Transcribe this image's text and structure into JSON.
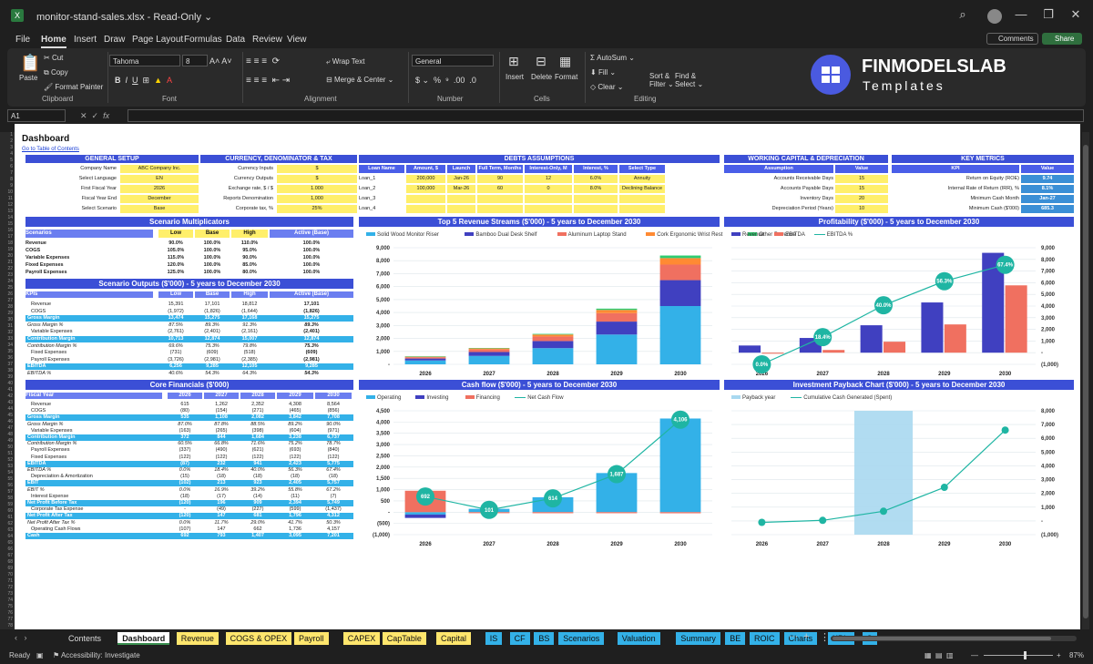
{
  "window": {
    "filename": "monitor-stand-sales.xlsx",
    "readonly": "Read-Only",
    "chevron": "⌄"
  },
  "menu": [
    "File",
    "Home",
    "Insert",
    "Draw",
    "Page Layout",
    "Formulas",
    "Data",
    "Review",
    "View"
  ],
  "menu_right": {
    "comments": "Comments",
    "share": "Share"
  },
  "ribbon": {
    "clipboard": {
      "paste": "Paste",
      "cut": "Cut",
      "copy": "Copy",
      "format_painter": "Format Painter",
      "label": "Clipboard"
    },
    "font": {
      "name": "Tahoma",
      "size": "8",
      "label": "Font"
    },
    "alignment": {
      "wrap": "Wrap Text",
      "merge": "Merge & Center",
      "label": "Alignment"
    },
    "number": {
      "format": "General",
      "label": "Number"
    },
    "cells": {
      "insert": "Insert",
      "delete": "Delete",
      "format": "Format",
      "label": "Cells"
    },
    "editing": {
      "autosum": "AutoSum",
      "fill": "Fill",
      "clear": "Clear",
      "sort": "Sort &",
      "filter": "Filter",
      "find": "Find &",
      "select": "Select",
      "label": "Editing"
    }
  },
  "logo": {
    "name": "FINMODELSLAB",
    "sub": "Templates"
  },
  "formula": {
    "cellref": "A1",
    "fx": "fx"
  },
  "columns": [
    "A",
    "B",
    "C",
    "D",
    "E",
    "F",
    "G",
    "H",
    "I",
    "J",
    "K",
    "L",
    "M",
    "N",
    "O",
    "P",
    "Q",
    "R",
    "S",
    "T",
    "U",
    "V",
    "W",
    "X",
    "Y",
    "Z",
    "AA",
    "AB",
    "AC",
    "AD"
  ],
  "dashboard": {
    "title": "Dashboard",
    "toc": "Go to Table of Contents"
  },
  "general_setup": {
    "title": "GENERAL SETUP",
    "rows": [
      [
        "Company Name",
        "ABC Company Inc."
      ],
      [
        "Select Language",
        "EN"
      ],
      [
        "First Fiscal Year",
        "2026"
      ],
      [
        "Fiscal Year End",
        "December"
      ],
      [
        "Select Scenario",
        "Base"
      ]
    ]
  },
  "currency": {
    "title": "CURRENCY, DENOMINATOR & TAX",
    "rows": [
      [
        "Currency Inputs",
        "$"
      ],
      [
        "Currency Outputs",
        "$"
      ],
      [
        "Exchange rate, $ / $",
        "1.000"
      ],
      [
        "Reports Denomination",
        "1,000"
      ],
      [
        "Corporate tax, %",
        "25%"
      ]
    ]
  },
  "debts": {
    "title": "DEBTS ASSUMPTIONS",
    "headers": [
      "Loan Name",
      "Amount, $",
      "Launch",
      "Full Term, Months",
      "Interest-Only, M",
      "Interest, %",
      "Select Type"
    ],
    "rows": [
      [
        "Loan_1",
        "200,000",
        "Jan-26",
        "90",
        "12",
        "6.0%",
        "Annuity"
      ],
      [
        "Loan_2",
        "100,000",
        "Mar-26",
        "60",
        "0",
        "8.0%",
        "Declining Balance"
      ],
      [
        "Loan_3",
        "",
        "",
        "",
        "",
        "",
        ""
      ],
      [
        "Loan_4",
        "",
        "",
        "",
        "",
        "",
        ""
      ]
    ]
  },
  "working_capital": {
    "title": "WORKING CAPITAL & DEPRECIATION",
    "headers": [
      "Assumption",
      "Value"
    ],
    "rows": [
      [
        "Accounts Receivable Days",
        "15"
      ],
      [
        "Accounts Payable Days",
        "15"
      ],
      [
        "Inventory Days",
        "20"
      ],
      [
        "Depreciation Period (Years)",
        "10"
      ]
    ]
  },
  "key_metrics": {
    "title": "KEY METRICS",
    "headers": [
      "KPI",
      "Value"
    ],
    "rows": [
      [
        "Return on Equity (ROE)",
        "9.74"
      ],
      [
        "Internal Rate of Return (IRR), %",
        "8.1%"
      ],
      [
        "Minimum Cash Month",
        "Jan-27"
      ],
      [
        "Minimum Cash ($'000)",
        "685.3"
      ]
    ]
  },
  "scenario_mult": {
    "title": "Scenario Multiplicators",
    "headers": [
      "Scenarios",
      "Low",
      "Base",
      "High",
      "Active (Base)"
    ],
    "rows": [
      [
        "Revenue",
        "90.0%",
        "100.0%",
        "110.0%",
        "100.0%"
      ],
      [
        "COGS",
        "105.0%",
        "100.0%",
        "95.0%",
        "100.0%"
      ],
      [
        "Variable Expenses",
        "115.0%",
        "100.0%",
        "90.0%",
        "100.0%"
      ],
      [
        "Fixed Expenses",
        "120.0%",
        "100.0%",
        "85.0%",
        "100.0%"
      ],
      [
        "Payroll Expenses",
        "125.0%",
        "100.0%",
        "80.0%",
        "100.0%"
      ]
    ]
  },
  "scenario_out": {
    "title": "Scenario Outputs ($'000) - 5 years to December 2030",
    "headers": [
      "KPIs",
      "Low",
      "Base",
      "High",
      "Active (Base)"
    ],
    "rows": [
      {
        "k": "Revenue",
        "v": [
          "15,391",
          "17,101",
          "18,812",
          "17,101"
        ],
        "s": "n"
      },
      {
        "k": "COGS",
        "v": [
          "(1,972)",
          "(1,826)",
          "(1,644)",
          "(1,826)"
        ],
        "s": "n"
      },
      {
        "k": "Gross Margin",
        "v": [
          "13,474",
          "15,275",
          "17,168",
          "15,275"
        ],
        "s": "b"
      },
      {
        "k": "Gross Margin %",
        "v": [
          "87.5%",
          "89.3%",
          "91.3%",
          "89.3%"
        ],
        "s": "i"
      },
      {
        "k": "Variable Expenses",
        "v": [
          "(2,761)",
          "(2,401)",
          "(2,161)",
          "(2,401)"
        ],
        "s": "n"
      },
      {
        "k": "Contribution Margin",
        "v": [
          "10,713",
          "12,874",
          "15,007",
          "12,874"
        ],
        "s": "b"
      },
      {
        "k": "Contribution Margin %",
        "v": [
          "69.6%",
          "75.3%",
          "79.8%",
          "75.3%"
        ],
        "s": "i"
      },
      {
        "k": "Fixed Expenses",
        "v": [
          "(731)",
          "(609)",
          "(518)",
          "(609)"
        ],
        "s": "n"
      },
      {
        "k": "Payroll Expenses",
        "v": [
          "(3,726)",
          "(2,981)",
          "(2,385)",
          "(2,981)"
        ],
        "s": "n"
      },
      {
        "k": "EBITDA",
        "v": [
          "6,256",
          "9,285",
          "12,105",
          "9,285"
        ],
        "s": "b"
      },
      {
        "k": "EBITDA %",
        "v": [
          "40.6%",
          "54.3%",
          "64.3%",
          "54.3%"
        ],
        "s": "i"
      }
    ]
  },
  "core": {
    "title": "Core Financials ($'000)",
    "headers": [
      "Fiscal Year",
      "2026",
      "2027",
      "2028",
      "2029",
      "2030"
    ],
    "rows": [
      {
        "k": "Revenue",
        "v": [
          "615",
          "1,262",
          "2,352",
          "4,308",
          "8,564"
        ],
        "s": "n"
      },
      {
        "k": "COGS",
        "v": [
          "(80)",
          "(154)",
          "(271)",
          "(465)",
          "(856)"
        ],
        "s": "n"
      },
      {
        "k": "Gross Margin",
        "v": [
          "535",
          "1,108",
          "2,082",
          "3,842",
          "7,708"
        ],
        "s": "b"
      },
      {
        "k": "Gross Margin %",
        "v": [
          "87.0%",
          "87.8%",
          "88.5%",
          "89.2%",
          "90.0%"
        ],
        "s": "i"
      },
      {
        "k": "Variable Expenses",
        "v": [
          "(163)",
          "(265)",
          "(398)",
          "(604)",
          "(971)"
        ],
        "s": "n"
      },
      {
        "k": "Contribution Margin",
        "v": [
          "372",
          "844",
          "1,684",
          "3,238",
          "6,737"
        ],
        "s": "b"
      },
      {
        "k": "Contribution Margin %",
        "v": [
          "60.5%",
          "66.8%",
          "71.6%",
          "75.2%",
          "78.7%"
        ],
        "s": "i"
      },
      {
        "k": "Payroll Expenses",
        "v": [
          "(337)",
          "(490)",
          "(621)",
          "(693)",
          "(840)"
        ],
        "s": "n"
      },
      {
        "k": "Fixed Expenses",
        "v": [
          "(122)",
          "(122)",
          "(122)",
          "(122)",
          "(122)"
        ],
        "s": "n"
      },
      {
        "k": "EBITDA",
        "v": [
          "(87)",
          "232",
          "941",
          "2,423",
          "5,775"
        ],
        "s": "b"
      },
      {
        "k": "EBITDA %",
        "v": [
          "0.0%",
          "18.4%",
          "40.0%",
          "56.3%",
          "67.4%"
        ],
        "s": "i"
      },
      {
        "k": "Depreciation & Amortization",
        "v": [
          "(15)",
          "(18)",
          "(18)",
          "(18)",
          "(18)"
        ],
        "s": "n"
      },
      {
        "k": "EBIT",
        "v": [
          "(102)",
          "213",
          "923",
          "2,405",
          "5,757"
        ],
        "s": "b"
      },
      {
        "k": "EBIT %",
        "v": [
          "0.0%",
          "16.9%",
          "39.2%",
          "55.8%",
          "67.2%"
        ],
        "s": "i"
      },
      {
        "k": "Interest Expense",
        "v": [
          "(18)",
          "(17)",
          "(14)",
          "(11)",
          "(7)"
        ],
        "s": "n"
      },
      {
        "k": "Net Profit Before Tax",
        "v": [
          "(120)",
          "196",
          "909",
          "2,394",
          "5,749"
        ],
        "s": "b"
      },
      {
        "k": "Corporate Tax Expense",
        "v": [
          "-",
          "(49)",
          "(227)",
          "(599)",
          "(1,437)"
        ],
        "s": "n"
      },
      {
        "k": "Net Profit After Tax",
        "v": [
          "(120)",
          "147",
          "681",
          "1,796",
          "4,312"
        ],
        "s": "b"
      },
      {
        "k": "Net Profit After Tax %",
        "v": [
          "0.0%",
          "11.7%",
          "29.0%",
          "41.7%",
          "50.3%"
        ],
        "s": "i"
      },
      {
        "k": "Operating Cash Flows",
        "v": [
          "(107)",
          "147",
          "662",
          "1,736",
          "4,157"
        ],
        "s": "n"
      },
      {
        "k": "Cash",
        "v": [
          "692",
          "793",
          "1,407",
          "3,095",
          "7,201"
        ],
        "s": "b"
      }
    ]
  },
  "colors": {
    "blue_dark": "#3b4fd6",
    "blue_light": "#33b1e8",
    "red": "#f07060",
    "teal": "#1fb5a3",
    "orange": "#ff8a33",
    "purple": "#4040c0",
    "yellow": "#ffef6b"
  },
  "chart_data": [
    {
      "type": "bar",
      "title": "Top 5 Revenue Streams ($'000) - 5 years to December 2030",
      "categories": [
        "2026",
        "2027",
        "2028",
        "2029",
        "2030"
      ],
      "ylim": [
        0,
        9000
      ],
      "yticks": [
        "-",
        "1,000",
        "2,000",
        "3,000",
        "4,000",
        "5,000",
        "6,000",
        "7,000",
        "8,000",
        "9,000"
      ],
      "series": [
        {
          "name": "Solid Wood Monitor Riser",
          "values": [
            300,
            650,
            1250,
            2300,
            4500
          ]
        },
        {
          "name": "Bamboo Dual Desk Shelf",
          "values": [
            150,
            300,
            550,
            1000,
            2000
          ]
        },
        {
          "name": "Aluminum Laptop Stand",
          "values": [
            100,
            200,
            350,
            650,
            1200
          ]
        },
        {
          "name": "Cork Ergonomic Wrist Rest",
          "values": [
            50,
            80,
            150,
            250,
            500
          ]
        },
        {
          "name": "Other Revenue",
          "values": [
            15,
            30,
            50,
            100,
            200
          ]
        }
      ],
      "stacked": true,
      "legend": "top"
    },
    {
      "type": "bar",
      "title": "Profitability ($'000) - 5 years to December 2030",
      "categories": [
        "2026",
        "2027",
        "2028",
        "2029",
        "2030"
      ],
      "ylim": [
        -1000,
        9000
      ],
      "yticks": [
        "(1,000)",
        "-",
        "1,000",
        "2,000",
        "3,000",
        "4,000",
        "5,000",
        "6,000",
        "7,000",
        "8,000",
        "9,000"
      ],
      "series": [
        {
          "name": "Revenue",
          "values": [
            615,
            1262,
            2352,
            4308,
            8564
          ]
        },
        {
          "name": "EBITDA",
          "values": [
            -87,
            232,
            941,
            2423,
            5775
          ]
        }
      ],
      "line": {
        "name": "EBITDA %",
        "values": [
          0.0,
          18.4,
          40.0,
          56.3,
          67.4
        ],
        "labels": [
          "0.0%",
          "18.4%",
          "40.0%",
          "56.3%",
          "67.4%"
        ]
      },
      "legend": "top"
    },
    {
      "type": "bar",
      "title": "Cash flow ($'000) - 5 years to December 2030",
      "categories": [
        "2026",
        "2027",
        "2028",
        "2029",
        "2030"
      ],
      "ylim": [
        -1000,
        4500
      ],
      "yticks": [
        "(1,000)",
        "(500)",
        "-",
        "500",
        "1,000",
        "1,500",
        "2,000",
        "2,500",
        "3,000",
        "3,500",
        "4,000",
        "4,500"
      ],
      "series": [
        {
          "name": "Operating",
          "values": [
            -107,
            147,
            662,
            1736,
            4157
          ]
        },
        {
          "name": "Investing",
          "values": [
            -150,
            0,
            0,
            0,
            0
          ]
        },
        {
          "name": "Financing",
          "values": [
            950,
            -46,
            -48,
            -48,
            -51
          ]
        }
      ],
      "line": {
        "name": "Net Cash Flow",
        "values": [
          692,
          101,
          614,
          1687,
          4106
        ],
        "labels": [
          "692",
          "101",
          "614",
          "1,687",
          "4,106"
        ]
      },
      "legend": "top"
    },
    {
      "type": "line",
      "title": "Investment Payback Chart ($'000) - 5 years to December 2030",
      "categories": [
        "2026",
        "2027",
        "2028",
        "2029",
        "2030"
      ],
      "ylim": [
        -1000,
        8000
      ],
      "yticks": [
        "(1,000)",
        "-",
        "1,000",
        "2,000",
        "3,000",
        "4,000",
        "5,000",
        "6,000",
        "7,000",
        "8,000"
      ],
      "series": [
        {
          "name": "Cumulative Cash Generated (Spent)",
          "values": [
            -107,
            40,
            702,
            2438,
            6595
          ]
        }
      ],
      "payback": {
        "name": "Payback year",
        "category": "2028"
      },
      "legend": "top"
    }
  ],
  "sheet_tabs": [
    {
      "n": "Contents",
      "c": "#1f1f1f",
      "t": "#ddd"
    },
    {
      "n": "Dashboard",
      "c": "#ffffff",
      "t": "#111"
    },
    {
      "n": "Revenue",
      "c": "#ffe66d",
      "t": "#111"
    },
    {
      "n": "COGS & OPEX",
      "c": "#ffe66d",
      "t": "#111"
    },
    {
      "n": "Payroll",
      "c": "#ffe66d",
      "t": "#111"
    },
    {
      "n": "CAPEX",
      "c": "#ffe66d",
      "t": "#111"
    },
    {
      "n": "CapTable",
      "c": "#ffe66d",
      "t": "#111"
    },
    {
      "n": "Capital",
      "c": "#ffe66d",
      "t": "#111"
    },
    {
      "n": "IS",
      "c": "#33b1e8",
      "t": "#111"
    },
    {
      "n": "CF",
      "c": "#33b1e8",
      "t": "#111"
    },
    {
      "n": "BS",
      "c": "#33b1e8",
      "t": "#111"
    },
    {
      "n": "Scenarios",
      "c": "#33b1e8",
      "t": "#111"
    },
    {
      "n": "Valuation",
      "c": "#33b1e8",
      "t": "#111"
    },
    {
      "n": "Summary",
      "c": "#33b1e8",
      "t": "#111"
    },
    {
      "n": "BE",
      "c": "#33b1e8",
      "t": "#111"
    },
    {
      "n": "ROIC",
      "c": "#33b1e8",
      "t": "#111"
    },
    {
      "n": "Charts",
      "c": "#33b1e8",
      "t": "#111"
    },
    {
      "n": "KPIs",
      "c": "#33b1e8",
      "t": "#111"
    },
    {
      "n": "S",
      "c": "#33b1e8",
      "t": "#111"
    }
  ],
  "status": {
    "ready": "Ready",
    "accessibility": "Accessibility: Investigate",
    "zoom": "87%"
  }
}
